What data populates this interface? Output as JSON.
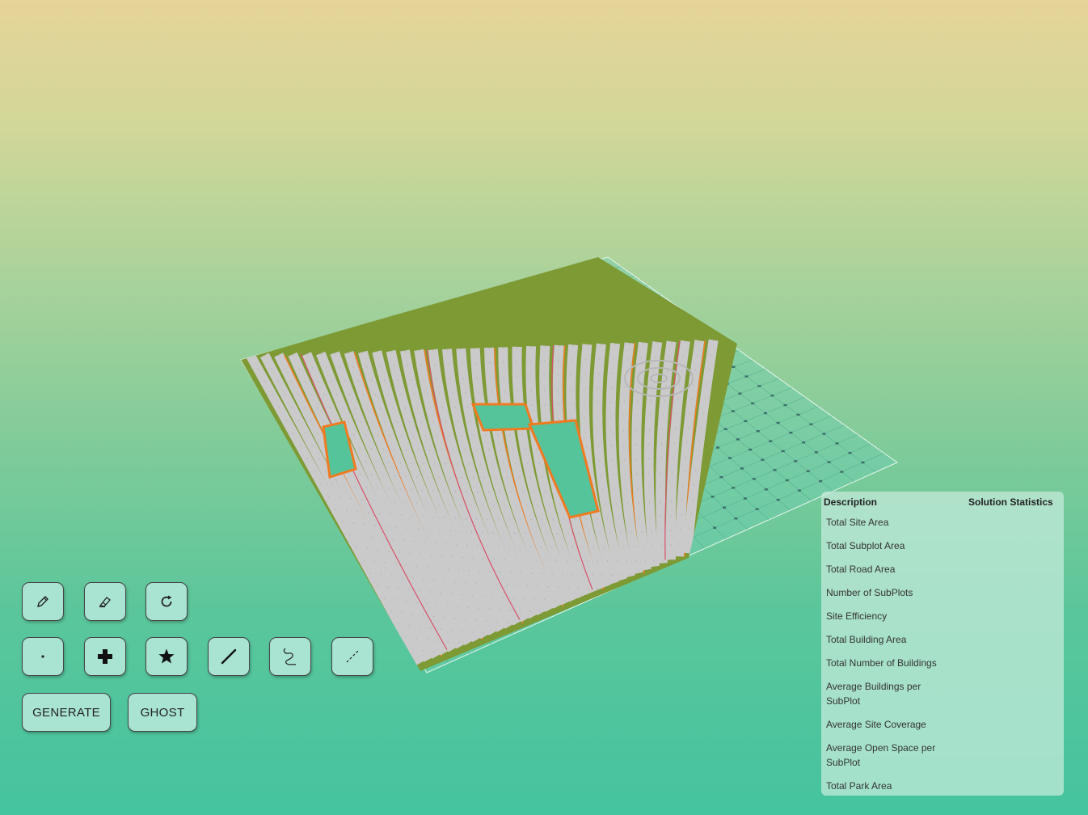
{
  "toolbar": {
    "row1": [
      {
        "name": "pencil-button",
        "icon": "pencil-icon"
      },
      {
        "name": "eraser-button",
        "icon": "eraser-icon"
      },
      {
        "name": "reset-button",
        "icon": "rotate-icon"
      }
    ],
    "row2": [
      {
        "name": "point-tool-button",
        "icon": "dot-icon"
      },
      {
        "name": "cross-tool-button",
        "icon": "plus-icon"
      },
      {
        "name": "star-tool-button",
        "icon": "star-icon"
      },
      {
        "name": "line-tool-button",
        "icon": "line-icon"
      },
      {
        "name": "curve-tool-button",
        "icon": "squiggle-icon"
      },
      {
        "name": "dashed-line-tool-button",
        "icon": "dashed-line-icon"
      }
    ],
    "generate_label": "GENERATE",
    "ghost_label": "GHOST"
  },
  "stats": {
    "col_description": "Description",
    "col_statistics": "Solution Statistics",
    "rows": [
      "Total Site Area",
      "Total Subplot Area",
      "Total Road Area",
      "Number of SubPlots",
      "Site Efficiency",
      "Total Building Area",
      "Total Number of Buildings",
      "Average Buildings per SubPlot",
      "Average Site Coverage",
      "Average Open Space per SubPlot",
      "Total Park Area"
    ]
  },
  "colors": {
    "button_bg": "#a9e3d2",
    "building": "#c9c9c9",
    "road": "#7a9a2e",
    "highlight_road": "#f07a20",
    "grid": "#6fc8b0"
  }
}
